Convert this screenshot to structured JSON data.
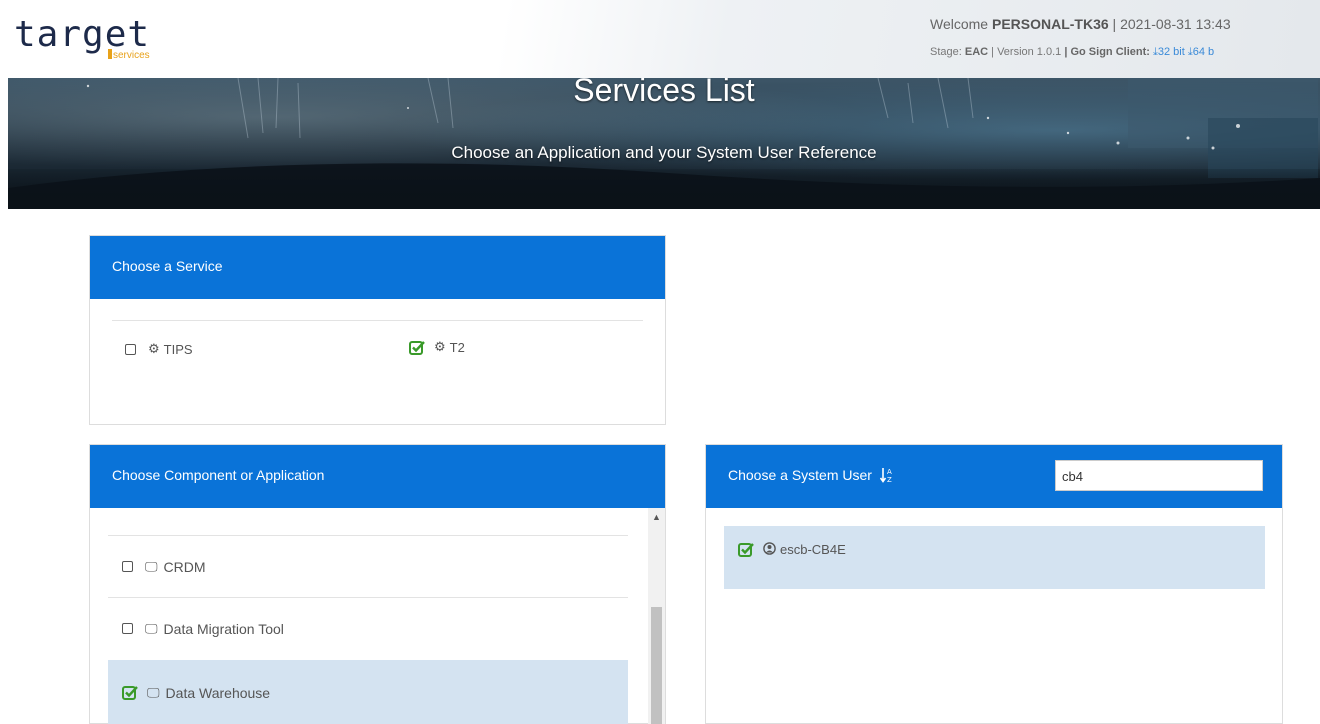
{
  "header": {
    "logo_text": "target",
    "logo_sub": "services",
    "welcome_prefix": "Welcome ",
    "username": "PERSONAL-TK36",
    "separator": " | ",
    "datetime": "2021-08-31 13:43",
    "stage_label": "Stage:",
    "stage_value": " EAC",
    "version_text": " | Version 1.0.1 ",
    "sign_label": "| Go Sign Client:",
    "dl_32": "32 bit",
    "dl_64": "64 b"
  },
  "banner": {
    "title": "Services List",
    "subtitle": "Choose an Application and your System User Reference"
  },
  "service_panel": {
    "title": "Choose a Service",
    "options": [
      {
        "label": "TIPS",
        "checked": false
      },
      {
        "label": "T2",
        "checked": true
      }
    ]
  },
  "component_panel": {
    "title": "Choose Component or Application",
    "items": [
      {
        "label": "CRDM",
        "checked": false
      },
      {
        "label": "Data Migration Tool",
        "checked": false
      },
      {
        "label": "Data Warehouse",
        "checked": true
      }
    ]
  },
  "system_user_panel": {
    "title": "Choose a System User",
    "search_value": "cb4",
    "users": [
      {
        "label": "escb-CB4E",
        "checked": true
      }
    ]
  },
  "colors": {
    "panel_header": "#0a73d8",
    "selected_row": "#d4e3f1",
    "check_green": "#3a9a2a",
    "link_blue": "#3a8ad8",
    "logo_accent": "#e8a21a"
  }
}
